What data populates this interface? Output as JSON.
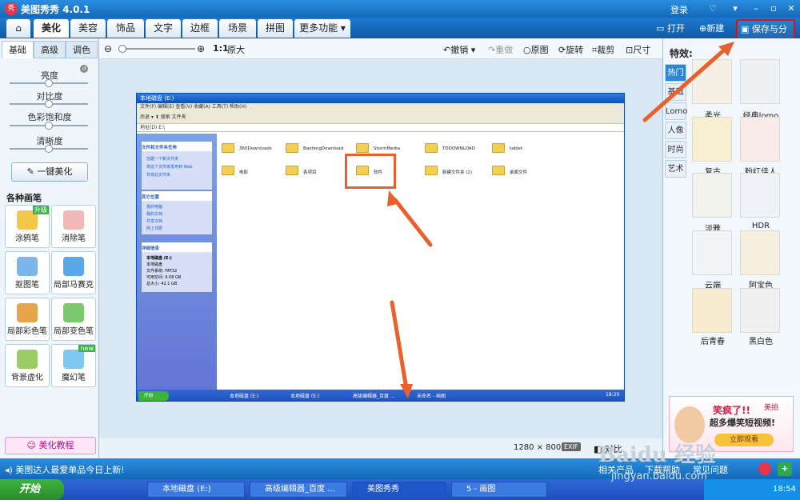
{
  "window": {
    "title": "美图秀秀 4.0.1",
    "logo_text": "秀",
    "login": "登录"
  },
  "menu": {
    "tabs": [
      "美化",
      "美容",
      "饰品",
      "文字",
      "边框",
      "场景",
      "拼图",
      "更多功能 ▾"
    ],
    "open": "打开",
    "new": "新建",
    "save_share": "保存与分享"
  },
  "left": {
    "subtabs": [
      "基础",
      "高级",
      "调色"
    ],
    "sliders": [
      "亮度",
      "对比度",
      "色彩饱和度",
      "清晰度"
    ],
    "one_key": "一键美化",
    "brush_heading": "各种画笔",
    "tools": [
      "涂鸦笔",
      "消除笔",
      "抠图笔",
      "局部马赛克",
      "局部彩色笔",
      "局部变色笔",
      "背景虚化",
      "魔幻笔"
    ],
    "badge_hot": "升级",
    "badge_new": "new",
    "tutorial": "美化教程"
  },
  "toolbar": {
    "zoom_ratio": "1:1",
    "original_size": "原大",
    "undo": "撤销",
    "redo": "重做",
    "original": "原图",
    "rotate": "旋转",
    "crop": "裁剪",
    "size": "尺寸"
  },
  "status": {
    "dims": "1280 × 800",
    "exif": "EXIF",
    "compare": "对比"
  },
  "right": {
    "title": "特效:",
    "categories": [
      "热门",
      "基础",
      "Lomo",
      "人像",
      "时尚",
      "艺术"
    ],
    "effects": [
      "柔光",
      "经典lomo",
      "复古",
      "粉红佳人",
      "淡雅",
      "HDR",
      "云端",
      "阿宝色",
      "后青春",
      "黑白色"
    ]
  },
  "ad": {
    "line1": "笑疯了!!",
    "line2": "超多爆笑短视频!",
    "cta": "立即观看",
    "brand": "美拍"
  },
  "bottom": {
    "news": "美图达人最爱单品今日上新!",
    "item1": "相关产品",
    "item2": "下载帮助",
    "item3": "常见问题"
  },
  "taskbar": {
    "start": "开始",
    "items": [
      "本地磁盘 (E:)",
      "高级编辑器_百度 ...",
      "美图秀秀",
      "5 - 画图"
    ],
    "clock": "18:54"
  },
  "explorer": {
    "title": "本地磁盘 (E:)",
    "menu": "文件(F)  编辑(E)  查看(V)  收藏(A)  工具(T)  帮助(H)",
    "tools": "后退  ▾  ⬆  搜索  文件夹",
    "address": "地址(D)  E:\\",
    "tasks_heading": "文件和文件夹任务",
    "tasks": [
      "创建一个新文件夹",
      "将这个文件夹发布到 Web",
      "共享此文件夹"
    ],
    "places_heading": "其它位置",
    "places": [
      "我的电脑",
      "我的文档",
      "共享文档",
      "网上邻居"
    ],
    "details_heading": "详细信息",
    "details": [
      "本地磁盘 (E:)",
      "本地磁盘",
      "文件系统: FAT32",
      "可用空间: 9.08 GB",
      "总大小: 42.1 GB"
    ],
    "folders": [
      "360Downloads",
      "BaofengDownload",
      "StormMedia",
      "TDDOWNLOAD",
      "tablet",
      "电影",
      "各项目",
      "软件",
      "新建文件夹 (2)",
      "桌面文件"
    ],
    "task_start": "开始",
    "task_items": [
      "本地磁盘 (E:)",
      "本地磁盘 (E:)",
      "高级编辑器_百度 ...",
      "未命名 - 画图"
    ],
    "task_clock": "18:20"
  },
  "watermark": {
    "text": "Baidu 经验",
    "url": "jingyan.baidu.com"
  },
  "colors": {
    "accent": "#1468b8",
    "highlight": "#e8612c",
    "save_border": "#e01010"
  }
}
